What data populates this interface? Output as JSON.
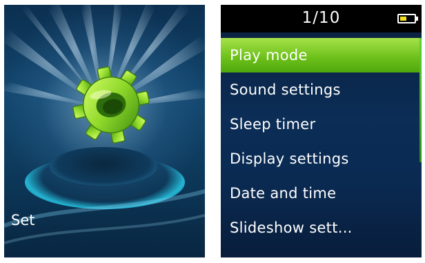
{
  "left_screen": {
    "label": "Set",
    "icon": "gear-icon"
  },
  "right_screen": {
    "page_indicator": "1/10",
    "battery_icon": "battery-icon",
    "battery_level": 0.45,
    "menu": {
      "selected_index": 0,
      "items": [
        {
          "label": "Play mode"
        },
        {
          "label": "Sound settings"
        },
        {
          "label": "Sleep timer"
        },
        {
          "label": "Display settings"
        },
        {
          "label": "Date and time"
        },
        {
          "label": "Slideshow sett..."
        }
      ]
    }
  },
  "colors": {
    "selection_green": "#6fc21c",
    "background_blue": "#0b2d56",
    "battery_yellow": "#f2e21e"
  }
}
